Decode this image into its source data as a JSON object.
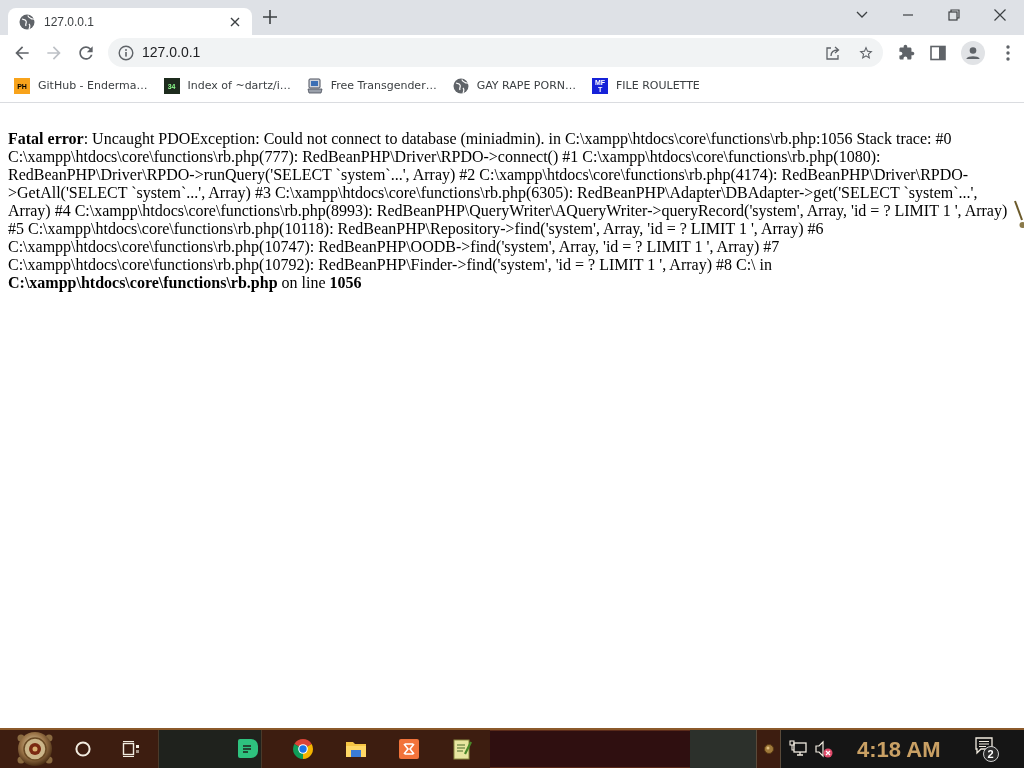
{
  "browser": {
    "tabs": [
      {
        "title": "127.0.0.1",
        "selected": true
      }
    ],
    "nav_buttons": [
      {
        "kind": "back",
        "disabled": false
      },
      {
        "kind": "forward",
        "disabled": true
      },
      {
        "kind": "reload",
        "disabled": false
      }
    ],
    "address_bar": {
      "value": "127.0.0.1"
    },
    "bookmarks": [
      {
        "label": "GitHub - Enderma…",
        "kind": "ph",
        "favicon_text": "PH"
      },
      {
        "label": "Index of ~dartz/i…",
        "kind": "counter",
        "favicon_text": "34"
      },
      {
        "label": "Free Transgender…",
        "kind": "computer"
      },
      {
        "label": "GAY RAPE PORN…",
        "kind": "globe"
      },
      {
        "label": "FILE ROULETTE",
        "kind": "mft",
        "favicon_text": "MFT"
      }
    ]
  },
  "page": {
    "error_message": "**Fatal error**: Uncaught PDOException: Could not connect to database (miniadmin). in C:\\xampp\\htdocs\\core\\functions\\rb.php:1056 Stack trace: #0 C:\\xampp\\htdocs\\core\\functions\\rb.php(777): RedBeanPHP\\Driver\\RPDO->connect() #1 C:\\xampp\\htdocs\\core\\functions\\rb.php(1080): RedBeanPHP\\Driver\\RPDO->runQuery('SELECT `system`...', Array) #2 C:\\xampp\\htdocs\\core\\functions\\rb.php(4174): RedBeanPHP\\Driver\\RPDO->GetAll('SELECT `system`...', Array) #3 C:\\xampp\\htdocs\\core\\functions\\rb.php(6305): RedBeanPHP\\Adapter\\DBAdapter->get('SELECT `system`...', Array) #4 C:\\xampp\\htdocs\\core\\functions\\rb.php(8993): RedBeanPHP\\QueryWriter\\AQueryWriter->queryRecord('system', Array, 'id = ? LIMIT 1 ', Array) #5 C:\\xampp\\htdocs\\core\\functions\\rb.php(10118): RedBeanPHP\\Repository->find('system', Array, 'id = ? LIMIT 1 ', Array) #6 C:\\xampp\\htdocs\\core\\functions\\rb.php(10747): RedBeanPHP\\OODB->find('system', Array, 'id = ? LIMIT 1 ', Array) #7 C:\\xampp\\htdocs\\core\\functions\\rb.php(10792): RedBeanPHP\\Finder->find('system', 'id = ? LIMIT 1 ', Array) #8 C:\\ in **C:\\xampp\\htdocs\\core\\functions\\rb.php** on line **1056**"
  },
  "taskbar": {
    "tray": {
      "volume_muted": true,
      "clock": "4:18 AM",
      "notification_count": "2"
    }
  }
}
